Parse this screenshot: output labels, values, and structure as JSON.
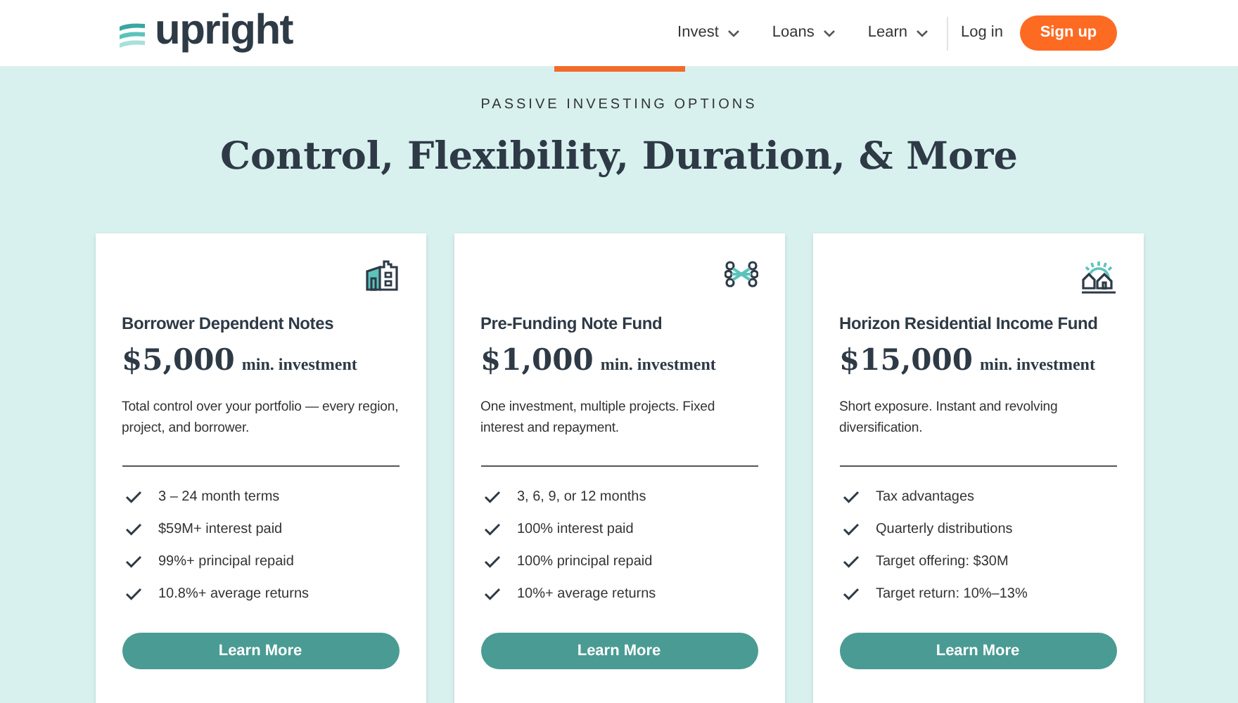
{
  "logo": {
    "text": "upright"
  },
  "nav": [
    {
      "label": "Invest",
      "dropdown": true
    },
    {
      "label": "Loans",
      "dropdown": true
    },
    {
      "label": "Learn",
      "dropdown": true
    }
  ],
  "login": "Log in",
  "signup": "Sign up",
  "eyebrow": "PASSIVE INVESTING OPTIONS",
  "heading": "Control, Flexibility, Duration, & More",
  "cards": [
    {
      "kind": "building",
      "title": "Borrower Dependent Notes",
      "price": "$5,000",
      "price_suffix": "min. investment",
      "description": "Total control over your portfolio — every region, project, and borrower.",
      "features": [
        "3 – 24 month terms",
        "$59M+ interest paid",
        "99%+ principal repaid",
        "10.8%+ average returns"
      ],
      "button": "Learn More"
    },
    {
      "kind": "network",
      "title": "Pre-Funding Note Fund",
      "price": "$1,000",
      "price_suffix": "min. investment",
      "description": "One investment, multiple projects. Fixed interest and repayment.",
      "features": [
        "3, 6, 9, or 12 months",
        "100% interest paid",
        "100% principal repaid",
        "10%+ average returns"
      ],
      "button": "Learn More"
    },
    {
      "kind": "houses",
      "title": "Horizon Residential Income Fund",
      "price": "$15,000",
      "price_suffix": "min. investment",
      "description": "Short exposure. Instant and revolving diversification.",
      "features": [
        "Tax advantages",
        "Quarterly distributions",
        "Target offering: $30M",
        "Target return: 10%–13%"
      ],
      "button": "Learn More"
    }
  ]
}
